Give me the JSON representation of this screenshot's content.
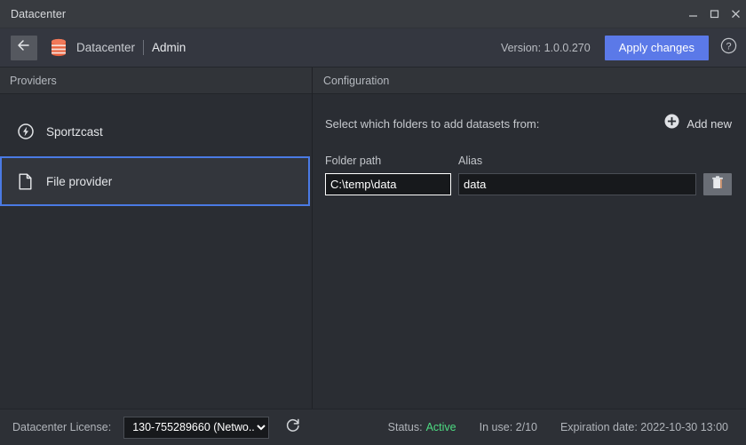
{
  "window": {
    "title": "Datacenter",
    "controls": {
      "minimize": "minimize-button",
      "maximize": "maximize-button",
      "close": "close-button"
    }
  },
  "header": {
    "back_icon": "arrow-left-icon",
    "app_icon": "database-icon",
    "breadcrumb_app": "Datacenter",
    "breadcrumb_page": "Admin",
    "version": "Version: 1.0.0.270",
    "apply_label": "Apply changes",
    "help_icon": "question-mark-circle-icon",
    "accent": "#5b79e8"
  },
  "providers": {
    "panel_title": "Providers",
    "items": [
      {
        "label": "Sportzcast",
        "icon": "lightning-bolt-circle-icon",
        "selected": false
      },
      {
        "label": "File provider",
        "icon": "file-document-icon",
        "selected": true
      }
    ],
    "selection_border": "#4a7ae4"
  },
  "configuration": {
    "panel_title": "Configuration",
    "hint": "Select which folders to add datasets from:",
    "add_new_label": "Add new",
    "add_new_icon": "plus-circle-icon",
    "labels": {
      "folder_path": "Folder path",
      "alias": "Alias"
    },
    "rows": [
      {
        "folder_path": "C:\\temp\\data",
        "folder_placeholder": "",
        "alias": "data",
        "alias_placeholder": "",
        "delete_icon": "trash-icon"
      }
    ]
  },
  "statusbar": {
    "license_label": "Datacenter License:",
    "license_selected": "130-755289660 (Netwo...",
    "license_options": [
      "130-755289660 (Netwo..."
    ],
    "refresh_icon": "refresh-icon",
    "status_label": "Status:",
    "status_value": "Active",
    "status_color": "#4ddb82",
    "in_use": "In use: 2/10",
    "expiration": "Expiration date: 2022-10-30 13:00"
  }
}
